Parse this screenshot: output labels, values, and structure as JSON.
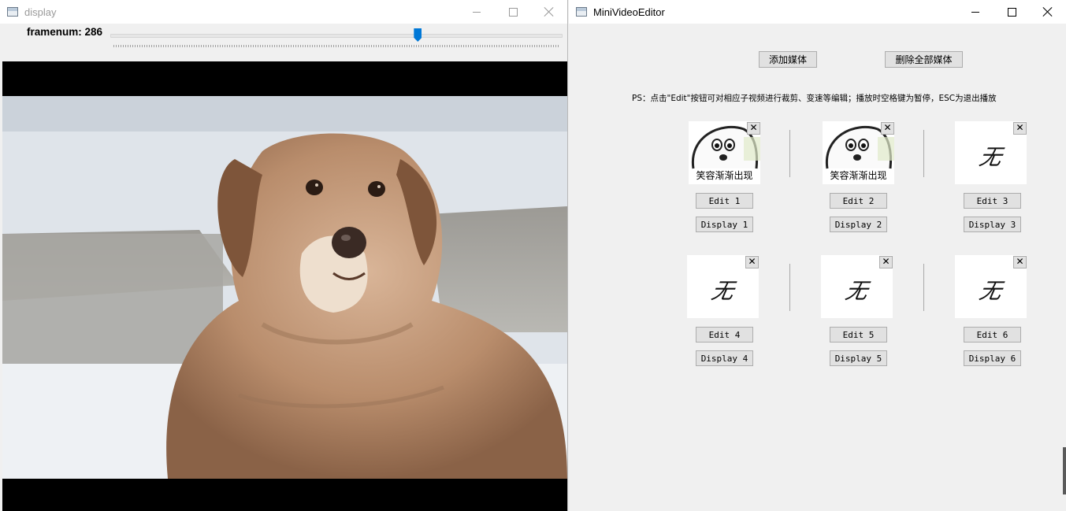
{
  "display_window": {
    "title": "display",
    "framenum_label": "framenum: 286",
    "slider_fraction": 0.68
  },
  "editor_window": {
    "title": "MiniVideoEditor",
    "add_media_label": "添加媒体",
    "delete_all_label": "删除全部媒体",
    "ps_text": "PS：点击\"Edit\"按钮可对相应子视频进行裁剪、变速等编辑；播放时空格键为暂停，ESC为退出播放",
    "close_glyph": "✕",
    "slots": [
      {
        "edit_label": "Edit 1",
        "display_label": "Display 1",
        "thumb_type": "face",
        "caption": "笑容渐渐出现"
      },
      {
        "edit_label": "Edit 2",
        "display_label": "Display 2",
        "thumb_type": "face",
        "caption": "笑容渐渐出现"
      },
      {
        "edit_label": "Edit 3",
        "display_label": "Display 3",
        "thumb_type": "none",
        "none_text": "无"
      },
      {
        "edit_label": "Edit 4",
        "display_label": "Display 4",
        "thumb_type": "none",
        "none_text": "无"
      },
      {
        "edit_label": "Edit 5",
        "display_label": "Display 5",
        "thumb_type": "none",
        "none_text": "无"
      },
      {
        "edit_label": "Edit 6",
        "display_label": "Display 6",
        "thumb_type": "none",
        "none_text": "无"
      }
    ]
  },
  "colors": {
    "slider_thumb": "#0078d7",
    "window_bg": "#f0f0f0",
    "button_bg": "#e1e1e1"
  }
}
